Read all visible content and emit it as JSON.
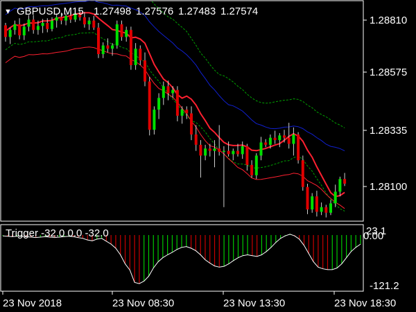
{
  "header": {
    "collapse_glyph": "▼",
    "symbol": "GBPUSD,M15",
    "ohlc": [
      "1.27498",
      "1.27576",
      "1.27483",
      "1.27574"
    ]
  },
  "price_axis": {
    "labels": [
      "1.28810",
      "1.28575",
      "1.28335",
      "1.28100"
    ],
    "values": [
      1.2881,
      1.28575,
      1.28335,
      1.281
    ],
    "current_price": 1.27574
  },
  "indicator": {
    "title": "Trigger -32.0 0.0 -32.0",
    "axis_labels": [
      "23.1",
      "0.00",
      "-121.2"
    ],
    "max": 23.1,
    "min": -121.2,
    "values": [
      -2,
      -3,
      -4,
      -3,
      -3,
      -4,
      -5,
      -6,
      -5,
      -4,
      -5,
      -6,
      -5,
      -4,
      -3,
      -4,
      -6,
      -8,
      -12,
      -14,
      -10,
      -8,
      -15,
      -22,
      -32,
      -48,
      -70,
      -85,
      -115,
      -118,
      -112,
      -100,
      -80,
      -65,
      -55,
      -48,
      -42,
      -35,
      -30,
      -28,
      -32,
      -38,
      -48,
      -60,
      -68,
      -75,
      -78,
      -76,
      -70,
      -62,
      -55,
      -50,
      -48,
      -50,
      -52,
      -48,
      -40,
      -30,
      -18,
      -8,
      -2,
      2,
      -2,
      -10,
      -25,
      -45,
      -65,
      -78,
      -82,
      -84,
      -84,
      -80,
      -70,
      -55,
      -40,
      -30,
      -22
    ]
  },
  "time_axis": {
    "labels": [
      "23 Nov 2018",
      "23 Nov 08:30",
      "23 Nov 13:30",
      "23 Nov 18:30"
    ]
  },
  "colors": {
    "background": "#000000",
    "grid_border": "#ffffff",
    "bull": "#00e000",
    "bear": "#e00000",
    "ma_fast": "#ff2030",
    "ma_slow": "#1020d0",
    "envelope": "#00a000",
    "hist_up": "#00c800",
    "hist_down": "#c80000",
    "indicator_line": "#ffffff"
  },
  "candles": [
    [
      1.28788,
      1.28798,
      1.28718,
      1.28738
    ],
    [
      1.28738,
      1.28778,
      1.28708,
      1.28768
    ],
    [
      1.28768,
      1.28808,
      1.28748,
      1.28792
    ],
    [
      1.28792,
      1.28818,
      1.28728,
      1.28745
    ],
    [
      1.28745,
      1.28795,
      1.28725,
      1.28782
    ],
    [
      1.28782,
      1.28832,
      1.28762,
      1.28812
    ],
    [
      1.28812,
      1.28832,
      1.28752,
      1.28768
    ],
    [
      1.28768,
      1.28808,
      1.28748,
      1.28785
    ],
    [
      1.28785,
      1.28815,
      1.28755,
      1.28798
    ],
    [
      1.28798,
      1.28818,
      1.28758,
      1.28772
    ],
    [
      1.28772,
      1.28822,
      1.28762,
      1.28808
    ],
    [
      1.28808,
      1.28838,
      1.28778,
      1.28822
    ],
    [
      1.28822,
      1.28842,
      1.28792,
      1.28808
    ],
    [
      1.28808,
      1.28838,
      1.28788,
      1.28828
    ],
    [
      1.28828,
      1.28848,
      1.28798,
      1.28812
    ],
    [
      1.28812,
      1.28852,
      1.28802,
      1.28838
    ],
    [
      1.28838,
      1.28852,
      1.28808,
      1.28822
    ],
    [
      1.28822,
      1.28845,
      1.28778,
      1.28792
    ],
    [
      1.28792,
      1.28822,
      1.28768,
      1.28808
    ],
    [
      1.28808,
      1.28828,
      1.28768,
      1.28778
    ],
    [
      1.28778,
      1.28798,
      1.28648,
      1.28665
    ],
    [
      1.28665,
      1.28715,
      1.28648,
      1.28702
    ],
    [
      1.28702,
      1.28732,
      1.28672,
      1.28688
    ],
    [
      1.28688,
      1.28712,
      1.28658,
      1.28702
    ],
    [
      1.28702,
      1.28808,
      1.28688,
      1.28792
    ],
    [
      1.28792,
      1.28808,
      1.28722,
      1.28738
    ],
    [
      1.28738,
      1.28782,
      1.28718,
      1.28768
    ],
    [
      1.28768,
      1.28782,
      1.28598,
      1.28618
    ],
    [
      1.28618,
      1.28712,
      1.28598,
      1.28688
    ],
    [
      1.28688,
      1.28702,
      1.28618,
      1.28638
    ],
    [
      1.28638,
      1.28672,
      1.28528,
      1.28548
    ],
    [
      1.28548,
      1.28568,
      1.28318,
      1.28342
    ],
    [
      1.28342,
      1.28442,
      1.28322,
      1.28428
    ],
    [
      1.28428,
      1.28498,
      1.28388,
      1.28478
    ],
    [
      1.28478,
      1.28548,
      1.28448,
      1.28528
    ],
    [
      1.28528,
      1.28552,
      1.28468,
      1.28498
    ],
    [
      1.28498,
      1.28528,
      1.28478,
      1.28512
    ],
    [
      1.28512,
      1.28528,
      1.28378,
      1.28402
    ],
    [
      1.28402,
      1.28442,
      1.28368,
      1.28428
    ],
    [
      1.28428,
      1.28442,
      1.28388,
      1.28412
    ],
    [
      1.28412,
      1.28442,
      1.28298,
      1.28322
    ],
    [
      1.28322,
      1.28362,
      1.28252,
      1.28278
    ],
    [
      1.28278,
      1.28298,
      1.28138,
      1.28232
    ],
    [
      1.28232,
      1.28278,
      1.28212,
      1.28262
    ],
    [
      1.28262,
      1.28282,
      1.28228,
      1.28252
    ],
    [
      1.28252,
      1.28298,
      1.28182,
      1.28262
    ],
    [
      1.28262,
      1.28362,
      1.28232,
      1.28248
    ],
    [
      1.28248,
      1.28272,
      1.28012,
      1.28252
    ],
    [
      1.28252,
      1.28292,
      1.28228,
      1.28238
    ],
    [
      1.28238,
      1.28262,
      1.28212,
      1.28252
    ],
    [
      1.28252,
      1.28282,
      1.28228,
      1.28238
    ],
    [
      1.28238,
      1.28292,
      1.28218,
      1.28272
    ],
    [
      1.28272,
      1.28282,
      1.28168,
      1.28192
    ],
    [
      1.28192,
      1.28212,
      1.28138,
      1.28148
    ],
    [
      1.28148,
      1.28242,
      1.28132,
      1.28232
    ],
    [
      1.28232,
      1.28312,
      1.28212,
      1.28288
    ],
    [
      1.28288,
      1.28302,
      1.28268,
      1.28278
    ],
    [
      1.28278,
      1.28322,
      1.28262,
      1.28308
    ],
    [
      1.28308,
      1.28338,
      1.28282,
      1.28298
    ],
    [
      1.28298,
      1.28328,
      1.28268,
      1.28318
    ],
    [
      1.28318,
      1.28342,
      1.28288,
      1.28308
    ],
    [
      1.28308,
      1.28372,
      1.28262,
      1.28282
    ],
    [
      1.28282,
      1.28352,
      1.28232,
      1.28322
    ],
    [
      1.28322,
      1.28332,
      1.28198,
      1.28212
    ],
    [
      1.28212,
      1.28232,
      1.28082,
      1.28098
    ],
    [
      1.28098,
      1.28112,
      1.27982,
      1.28002
    ],
    [
      1.28002,
      1.28072,
      1.27988,
      1.28058
    ],
    [
      1.28058,
      1.28082,
      1.27972,
      1.27992
    ],
    [
      1.27992,
      1.28032,
      1.27978,
      1.28012
    ],
    [
      1.28012,
      1.28022,
      1.27968,
      1.27988
    ],
    [
      1.27988,
      1.28042,
      1.27978,
      1.28028
    ],
    [
      1.28028,
      1.28108,
      1.28012,
      1.28078
    ],
    [
      1.28078,
      1.28142,
      1.28058,
      1.28132
    ],
    [
      1.28132,
      1.28158,
      1.28102,
      1.28112
    ]
  ]
}
